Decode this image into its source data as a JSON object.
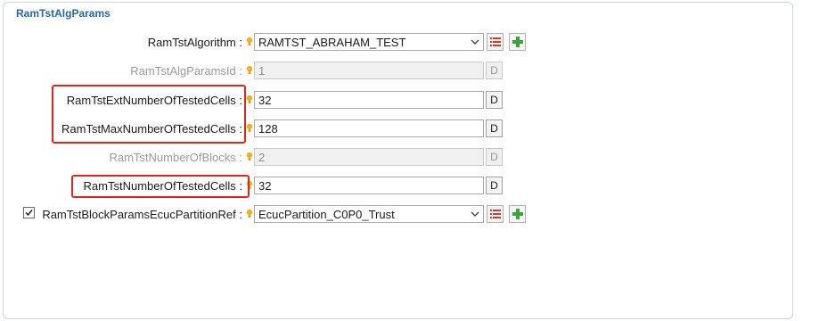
{
  "section": {
    "title": "RamTstAlgParams"
  },
  "rows": [
    {
      "label": "RamTstAlgorithm :",
      "value": "RAMTST_ABRAHAM_TEST",
      "type": "combo",
      "disabled": false
    },
    {
      "label": "RamTstAlgParamsId :",
      "value": "1",
      "type": "text",
      "disabled": true,
      "d": "D"
    },
    {
      "label": "RamTstExtNumberOfTestedCells :",
      "value": "32",
      "type": "text",
      "disabled": false,
      "d": "D"
    },
    {
      "label": "RamTstMaxNumberOfTestedCells :",
      "value": "128",
      "type": "text",
      "disabled": false,
      "d": "D"
    },
    {
      "label": "RamTstNumberOfBlocks :",
      "value": "2",
      "type": "text",
      "disabled": true,
      "d": "D"
    },
    {
      "label": "RamTstNumberOfTestedCells :",
      "value": "32",
      "type": "text",
      "disabled": false,
      "d": "D"
    },
    {
      "label": "RamTstBlockParamsEcucPartitionRef :",
      "value": "EcucPartition_C0P0_Trust",
      "type": "combo",
      "disabled": false,
      "checked": true
    }
  ],
  "icons": {
    "bulb": "lightbulb-icon",
    "list": "list-icon",
    "add": "add-icon",
    "chevron": "chevron-down-icon"
  },
  "colors": {
    "highlight": "#e0261a",
    "title": "#2a66a8",
    "bulb": "#f2b01e",
    "add": "#3aa63a",
    "list": "#d23a2a"
  }
}
